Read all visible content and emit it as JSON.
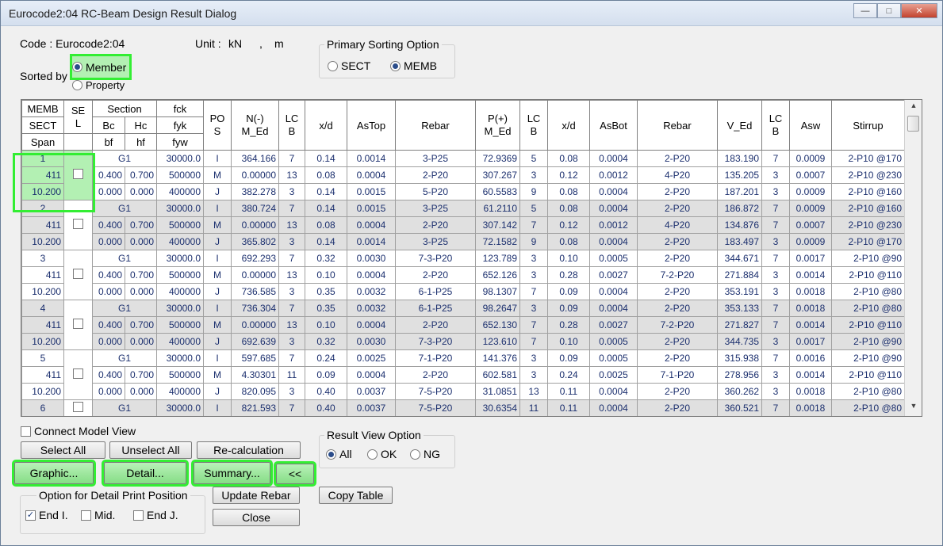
{
  "window": {
    "title": "Eurocode2:04 RC-Beam Design Result Dialog",
    "minimize": "—",
    "maximize": "□",
    "close": "✕"
  },
  "info": {
    "code_label": "Code : Eurocode2:04",
    "unit_label": "Unit :",
    "unit_force": "kN",
    "unit_sep": ",",
    "unit_length": "m"
  },
  "sorted_by": {
    "label": "Sorted by",
    "options": [
      {
        "label": "Member",
        "selected": true
      },
      {
        "label": "Property",
        "selected": false
      }
    ]
  },
  "primary_sorting": {
    "title": "Primary Sorting Option",
    "options": [
      {
        "label": "SECT",
        "selected": false
      },
      {
        "label": "MEMB",
        "selected": true
      }
    ]
  },
  "table": {
    "headers": {
      "memb": "MEMB",
      "sect": "SECT",
      "span": "Span",
      "sel": "SE\nL",
      "section": "Section",
      "bc": "Bc",
      "hc": "Hc",
      "bf": "bf",
      "hf": "hf",
      "fck": "fck",
      "fyk": "fyk",
      "fyw": "fyw",
      "pos": "PO\nS",
      "nm": "N(-)\nM_Ed",
      "lcb": "LC\nB",
      "xd": "x/d",
      "astop": "AsTop",
      "rebar": "Rebar",
      "pp": "P(+)\nM_Ed",
      "asbot": "AsBot",
      "ved": "V_Ed",
      "asw": "Asw",
      "stirrup": "Stirrup"
    },
    "groups": [
      {
        "memb": "1",
        "sect": "411",
        "span": "10.200",
        "section": "G1",
        "bc": "0.400",
        "hc": "0.700",
        "bf": "0.000",
        "hf": "0.000",
        "sel": false,
        "rows": [
          {
            "fc": "30000.0",
            "pos": "I",
            "nm": "364.166",
            "lcb1": "7",
            "xd1": "0.14",
            "astop": "0.0014",
            "rebar1": "3-P25",
            "pp": "72.9369",
            "lcb2": "5",
            "xd2": "0.08",
            "asbot": "0.0004",
            "rebar2": "2-P20",
            "ved": "183.190",
            "lcb3": "7",
            "asw": "0.0009",
            "stirrup": "2-P10 @170"
          },
          {
            "fc": "500000",
            "pos": "M",
            "nm": "0.00000",
            "lcb1": "13",
            "xd1": "0.08",
            "astop": "0.0004",
            "rebar1": "2-P20",
            "pp": "307.267",
            "lcb2": "3",
            "xd2": "0.12",
            "asbot": "0.0012",
            "rebar2": "4-P20",
            "ved": "135.205",
            "lcb3": "3",
            "asw": "0.0007",
            "stirrup": "2-P10 @230"
          },
          {
            "fc": "400000",
            "pos": "J",
            "nm": "382.278",
            "lcb1": "3",
            "xd1": "0.14",
            "astop": "0.0015",
            "rebar1": "5-P20",
            "pp": "60.5583",
            "lcb2": "9",
            "xd2": "0.08",
            "asbot": "0.0004",
            "rebar2": "2-P20",
            "ved": "187.201",
            "lcb3": "3",
            "asw": "0.0009",
            "stirrup": "2-P10 @160"
          }
        ]
      },
      {
        "memb": "2",
        "sect": "411",
        "span": "10.200",
        "section": "G1",
        "bc": "0.400",
        "hc": "0.700",
        "bf": "0.000",
        "hf": "0.000",
        "sel": false,
        "rows": [
          {
            "fc": "30000.0",
            "pos": "I",
            "nm": "380.724",
            "lcb1": "7",
            "xd1": "0.14",
            "astop": "0.0015",
            "rebar1": "3-P25",
            "pp": "61.2110",
            "lcb2": "5",
            "xd2": "0.08",
            "asbot": "0.0004",
            "rebar2": "2-P20",
            "ved": "186.872",
            "lcb3": "7",
            "asw": "0.0009",
            "stirrup": "2-P10 @160"
          },
          {
            "fc": "500000",
            "pos": "M",
            "nm": "0.00000",
            "lcb1": "13",
            "xd1": "0.08",
            "astop": "0.0004",
            "rebar1": "2-P20",
            "pp": "307.142",
            "lcb2": "7",
            "xd2": "0.12",
            "asbot": "0.0012",
            "rebar2": "4-P20",
            "ved": "134.876",
            "lcb3": "7",
            "asw": "0.0007",
            "stirrup": "2-P10 @230"
          },
          {
            "fc": "400000",
            "pos": "J",
            "nm": "365.802",
            "lcb1": "3",
            "xd1": "0.14",
            "astop": "0.0014",
            "rebar1": "3-P25",
            "pp": "72.1582",
            "lcb2": "9",
            "xd2": "0.08",
            "asbot": "0.0004",
            "rebar2": "2-P20",
            "ved": "183.497",
            "lcb3": "3",
            "asw": "0.0009",
            "stirrup": "2-P10 @170"
          }
        ]
      },
      {
        "memb": "3",
        "sect": "411",
        "span": "10.200",
        "section": "G1",
        "bc": "0.400",
        "hc": "0.700",
        "bf": "0.000",
        "hf": "0.000",
        "sel": false,
        "rows": [
          {
            "fc": "30000.0",
            "pos": "I",
            "nm": "692.293",
            "lcb1": "7",
            "xd1": "0.32",
            "astop": "0.0030",
            "rebar1": "7-3-P20",
            "pp": "123.789",
            "lcb2": "3",
            "xd2": "0.10",
            "asbot": "0.0005",
            "rebar2": "2-P20",
            "ved": "344.671",
            "lcb3": "7",
            "asw": "0.0017",
            "stirrup": "2-P10 @90"
          },
          {
            "fc": "500000",
            "pos": "M",
            "nm": "0.00000",
            "lcb1": "13",
            "xd1": "0.10",
            "astop": "0.0004",
            "rebar1": "2-P20",
            "pp": "652.126",
            "lcb2": "3",
            "xd2": "0.28",
            "asbot": "0.0027",
            "rebar2": "7-2-P20",
            "ved": "271.884",
            "lcb3": "3",
            "asw": "0.0014",
            "stirrup": "2-P10 @110"
          },
          {
            "fc": "400000",
            "pos": "J",
            "nm": "736.585",
            "lcb1": "3",
            "xd1": "0.35",
            "astop": "0.0032",
            "rebar1": "6-1-P25",
            "pp": "98.1307",
            "lcb2": "7",
            "xd2": "0.09",
            "asbot": "0.0004",
            "rebar2": "2-P20",
            "ved": "353.191",
            "lcb3": "3",
            "asw": "0.0018",
            "stirrup": "2-P10 @80"
          }
        ]
      },
      {
        "memb": "4",
        "sect": "411",
        "span": "10.200",
        "section": "G1",
        "bc": "0.400",
        "hc": "0.700",
        "bf": "0.000",
        "hf": "0.000",
        "sel": false,
        "rows": [
          {
            "fc": "30000.0",
            "pos": "I",
            "nm": "736.304",
            "lcb1": "7",
            "xd1": "0.35",
            "astop": "0.0032",
            "rebar1": "6-1-P25",
            "pp": "98.2647",
            "lcb2": "3",
            "xd2": "0.09",
            "asbot": "0.0004",
            "rebar2": "2-P20",
            "ved": "353.133",
            "lcb3": "7",
            "asw": "0.0018",
            "stirrup": "2-P10 @80"
          },
          {
            "fc": "500000",
            "pos": "M",
            "nm": "0.00000",
            "lcb1": "13",
            "xd1": "0.10",
            "astop": "0.0004",
            "rebar1": "2-P20",
            "pp": "652.130",
            "lcb2": "7",
            "xd2": "0.28",
            "asbot": "0.0027",
            "rebar2": "7-2-P20",
            "ved": "271.827",
            "lcb3": "7",
            "asw": "0.0014",
            "stirrup": "2-P10 @110"
          },
          {
            "fc": "400000",
            "pos": "J",
            "nm": "692.639",
            "lcb1": "3",
            "xd1": "0.32",
            "astop": "0.0030",
            "rebar1": "7-3-P20",
            "pp": "123.610",
            "lcb2": "7",
            "xd2": "0.10",
            "asbot": "0.0005",
            "rebar2": "2-P20",
            "ved": "344.735",
            "lcb3": "3",
            "asw": "0.0017",
            "stirrup": "2-P10 @90"
          }
        ]
      },
      {
        "memb": "5",
        "sect": "411",
        "span": "10.200",
        "section": "G1",
        "bc": "0.400",
        "hc": "0.700",
        "bf": "0.000",
        "hf": "0.000",
        "sel": false,
        "rows": [
          {
            "fc": "30000.0",
            "pos": "I",
            "nm": "597.685",
            "lcb1": "7",
            "xd1": "0.24",
            "astop": "0.0025",
            "rebar1": "7-1-P20",
            "pp": "141.376",
            "lcb2": "3",
            "xd2": "0.09",
            "asbot": "0.0005",
            "rebar2": "2-P20",
            "ved": "315.938",
            "lcb3": "7",
            "asw": "0.0016",
            "stirrup": "2-P10 @90"
          },
          {
            "fc": "500000",
            "pos": "M",
            "nm": "4.30301",
            "lcb1": "11",
            "xd1": "0.09",
            "astop": "0.0004",
            "rebar1": "2-P20",
            "pp": "602.581",
            "lcb2": "3",
            "xd2": "0.24",
            "asbot": "0.0025",
            "rebar2": "7-1-P20",
            "ved": "278.956",
            "lcb3": "3",
            "asw": "0.0014",
            "stirrup": "2-P10 @110"
          },
          {
            "fc": "400000",
            "pos": "J",
            "nm": "820.095",
            "lcb1": "3",
            "xd1": "0.40",
            "astop": "0.0037",
            "rebar1": "7-5-P20",
            "pp": "31.0851",
            "lcb2": "13",
            "xd2": "0.11",
            "asbot": "0.0004",
            "rebar2": "2-P20",
            "ved": "360.262",
            "lcb3": "3",
            "asw": "0.0018",
            "stirrup": "2-P10 @80"
          }
        ]
      },
      {
        "memb": "6",
        "sect": "411",
        "span": "10.200",
        "section": "G1",
        "bc": "0.400",
        "hc": "0.700",
        "bf": "0.000",
        "hf": "0.000",
        "sel": false,
        "rows": [
          {
            "fc": "30000.0",
            "pos": "I",
            "nm": "821.593",
            "lcb1": "7",
            "xd1": "0.40",
            "astop": "0.0037",
            "rebar1": "7-5-P20",
            "pp": "30.6354",
            "lcb2": "11",
            "xd2": "0.11",
            "asbot": "0.0004",
            "rebar2": "2-P20",
            "ved": "360.521",
            "lcb3": "7",
            "asw": "0.0018",
            "stirrup": "2-P10 @80"
          }
        ]
      }
    ]
  },
  "controls": {
    "connect_model_view": {
      "label": "Connect Model View",
      "checked": false
    },
    "select_all": "Select All",
    "unselect_all": "Unselect All",
    "recalculation": "Re-calculation",
    "graphic": "Graphic...",
    "detail": "Detail...",
    "summary": "Summary...",
    "collapse": "<<",
    "update_rebar": "Update Rebar",
    "close": "Close",
    "copy_table": "Copy Table"
  },
  "result_view": {
    "title": "Result View Option",
    "options": [
      {
        "label": "All",
        "selected": true
      },
      {
        "label": "OK",
        "selected": false
      },
      {
        "label": "NG",
        "selected": false
      }
    ]
  },
  "detail_print": {
    "title": "Option for Detail Print Position",
    "options": [
      {
        "label": "End I.",
        "checked": true
      },
      {
        "label": "Mid.",
        "checked": false
      },
      {
        "label": "End J.",
        "checked": false
      }
    ]
  }
}
